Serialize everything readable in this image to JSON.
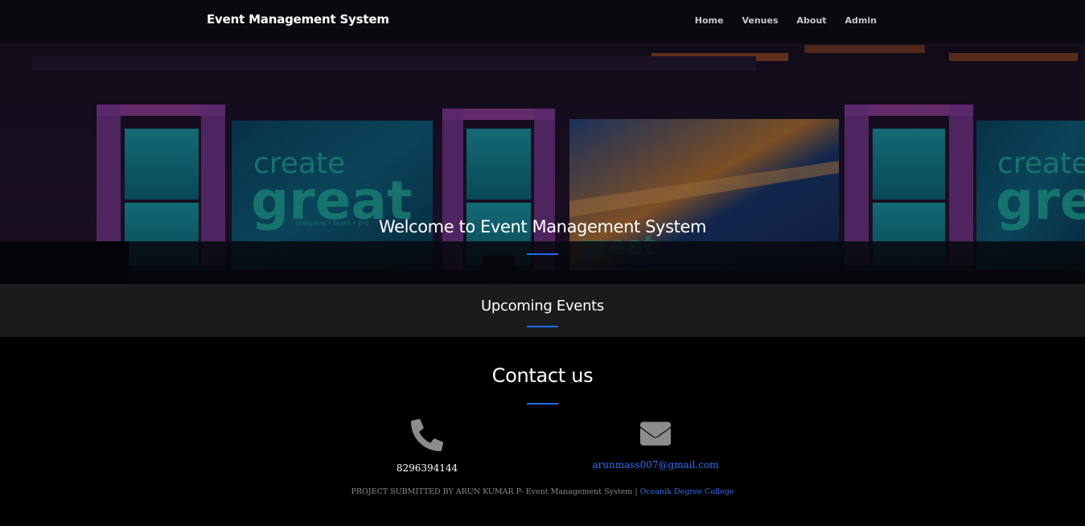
{
  "navbar": {
    "brand": "Event Management System",
    "links": [
      "Home",
      "Venues",
      "About",
      "Admin"
    ]
  },
  "hero": {
    "title": "Welcome to Event Management System",
    "screen_text_1": "create",
    "screen_text_2": "great",
    "screen_tagline": "company • team • pro"
  },
  "upcoming": {
    "title": "Upcoming Events"
  },
  "contact": {
    "title": "Contact us",
    "phone": "8296394144",
    "email": "arunmass007@gmail.com",
    "phone_icon": "phone-icon",
    "email_icon": "envelope-icon"
  },
  "footer": {
    "text": "PROJECT SUBMITTED BY ARUN KUMAR P- Event Management System |",
    "college": "Oceanik Degree College"
  },
  "colors": {
    "accent": "#1b6cf2",
    "link": "#2e6ff0",
    "upcoming_bg": "#1b1b1b",
    "page_bg": "#000000"
  }
}
